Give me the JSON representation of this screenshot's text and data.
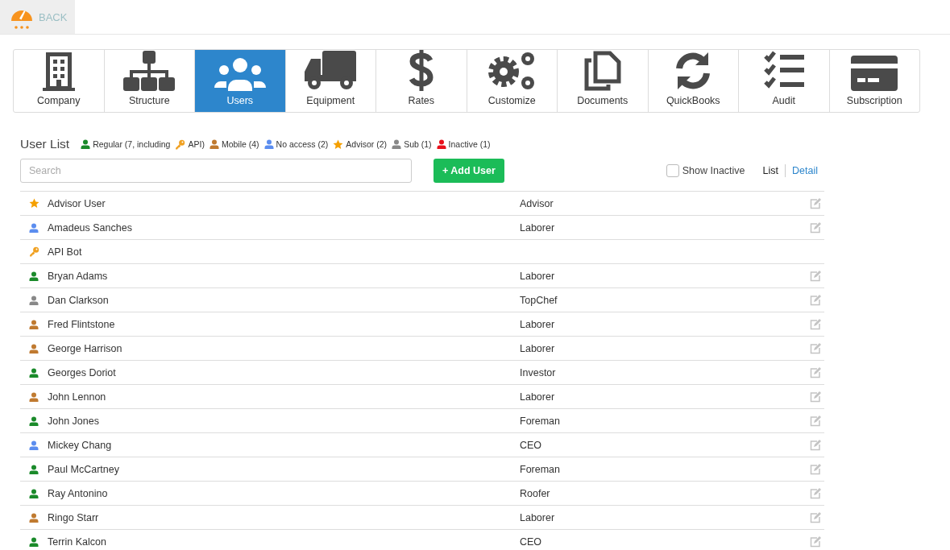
{
  "back": {
    "label": "BACK"
  },
  "tabs": [
    {
      "label": "Company",
      "selected": false
    },
    {
      "label": "Structure",
      "selected": false
    },
    {
      "label": "Users",
      "selected": true
    },
    {
      "label": "Equipment",
      "selected": false
    },
    {
      "label": "Rates",
      "selected": false
    },
    {
      "label": "Customize",
      "selected": false
    },
    {
      "label": "Documents",
      "selected": false
    },
    {
      "label": "QuickBooks",
      "selected": false
    },
    {
      "label": "Audit",
      "selected": false
    },
    {
      "label": "Subscription",
      "selected": false
    }
  ],
  "user_list": {
    "title": "User List",
    "legend": [
      {
        "kind": "person",
        "color": "#1a8a2a",
        "label": "Regular (7, including"
      },
      {
        "kind": "key",
        "color": "#f0a020",
        "label": "API)"
      },
      {
        "kind": "person",
        "color": "#c07a30",
        "label": "Mobile (4)"
      },
      {
        "kind": "person",
        "color": "#5b8def",
        "label": "No access (2)"
      },
      {
        "kind": "star",
        "color": "#f5a000",
        "label": "Advisor (2)"
      },
      {
        "kind": "person",
        "color": "#888888",
        "label": "Sub (1)"
      },
      {
        "kind": "person",
        "color": "#e8111b",
        "label": "Inactive (1)"
      }
    ],
    "search": {
      "placeholder": "Search"
    },
    "add_button": "+ Add User",
    "show_inactive": {
      "label": "Show Inactive",
      "checked": false
    },
    "views": [
      {
        "label": "List",
        "selected": true
      },
      {
        "label": "Detail",
        "selected": false
      }
    ],
    "rows": [
      {
        "kind": "star",
        "color": "#f5a000",
        "name": "Advisor User",
        "role": "Advisor",
        "editable": true
      },
      {
        "kind": "person",
        "color": "#5b8def",
        "name": "Amadeus Sanches",
        "role": "Laborer",
        "editable": true
      },
      {
        "kind": "key",
        "color": "#f0a020",
        "name": "API Bot",
        "editable": false
      },
      {
        "kind": "person",
        "color": "#1a8a2a",
        "name": "Bryan Adams",
        "role": "Laborer",
        "editable": true
      },
      {
        "kind": "person",
        "color": "#888888",
        "name": "Dan Clarkson",
        "role": "TopChef",
        "editable": true
      },
      {
        "kind": "person",
        "color": "#c07a30",
        "name": "Fred Flintstone",
        "role": "Laborer",
        "editable": true
      },
      {
        "kind": "person",
        "color": "#c07a30",
        "name": "George Harrison",
        "role": "Laborer",
        "editable": true
      },
      {
        "kind": "person",
        "color": "#1a8a2a",
        "name": "Georges Doriot",
        "role": "Investor",
        "editable": true
      },
      {
        "kind": "person",
        "color": "#c07a30",
        "name": "John Lennon",
        "role": "Laborer",
        "editable": true
      },
      {
        "kind": "person",
        "color": "#1a8a2a",
        "name": "John Jones",
        "role": "Foreman",
        "editable": true
      },
      {
        "kind": "person",
        "color": "#5b8def",
        "name": "Mickey Chang",
        "role": "CEO",
        "editable": true
      },
      {
        "kind": "person",
        "color": "#1a8a2a",
        "name": "Paul McCartney",
        "role": "Foreman",
        "editable": true
      },
      {
        "kind": "person",
        "color": "#1a8a2a",
        "name": "Ray Antonino",
        "role": "Roofer",
        "editable": true
      },
      {
        "kind": "person",
        "color": "#c07a30",
        "name": "Ringo Starr",
        "role": "Laborer",
        "editable": true
      },
      {
        "kind": "person",
        "color": "#1a8a2a",
        "name": "Terrin Kalcon",
        "role": "CEO",
        "editable": true
      }
    ]
  }
}
